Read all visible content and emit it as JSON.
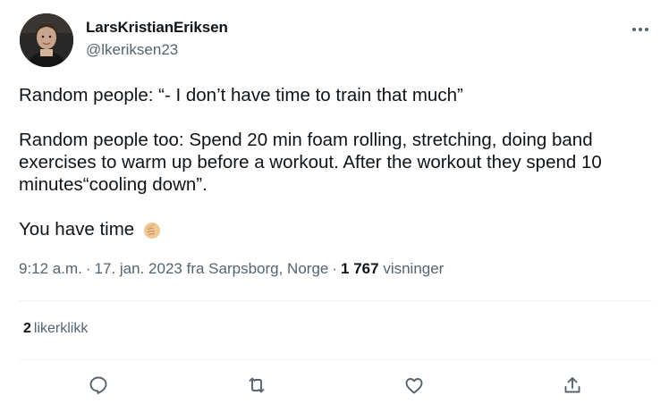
{
  "author": {
    "name": "LarsKristianEriksen",
    "handle": "@lkeriksen23"
  },
  "tweet": {
    "line1": "Random people: “- I don’t have time to train that much”",
    "line2": "Random people too: Spend 20 min foam rolling, stretching, doing band exercises to warm up before a workout. After the workout they spend 10 minutes“cooling down”.",
    "line3": "You have time",
    "emoji_icon": "pointing-hand-emoji"
  },
  "meta": {
    "time": "9:12 a.m.",
    "date": "17. jan. 2023",
    "location_prefix": "fra",
    "location": "Sarpsborg, Norge",
    "views_count": "1 767",
    "views_label": "visninger"
  },
  "stats": {
    "likes_count": "2",
    "likes_label": "likerklikk"
  },
  "actions": {
    "reply_icon": "reply-icon",
    "retweet_icon": "retweet-icon",
    "like_icon": "heart-icon",
    "share_icon": "share-icon"
  },
  "colors": {
    "text": "#0f1419",
    "secondary": "#536471",
    "divider": "#eff3f4"
  }
}
